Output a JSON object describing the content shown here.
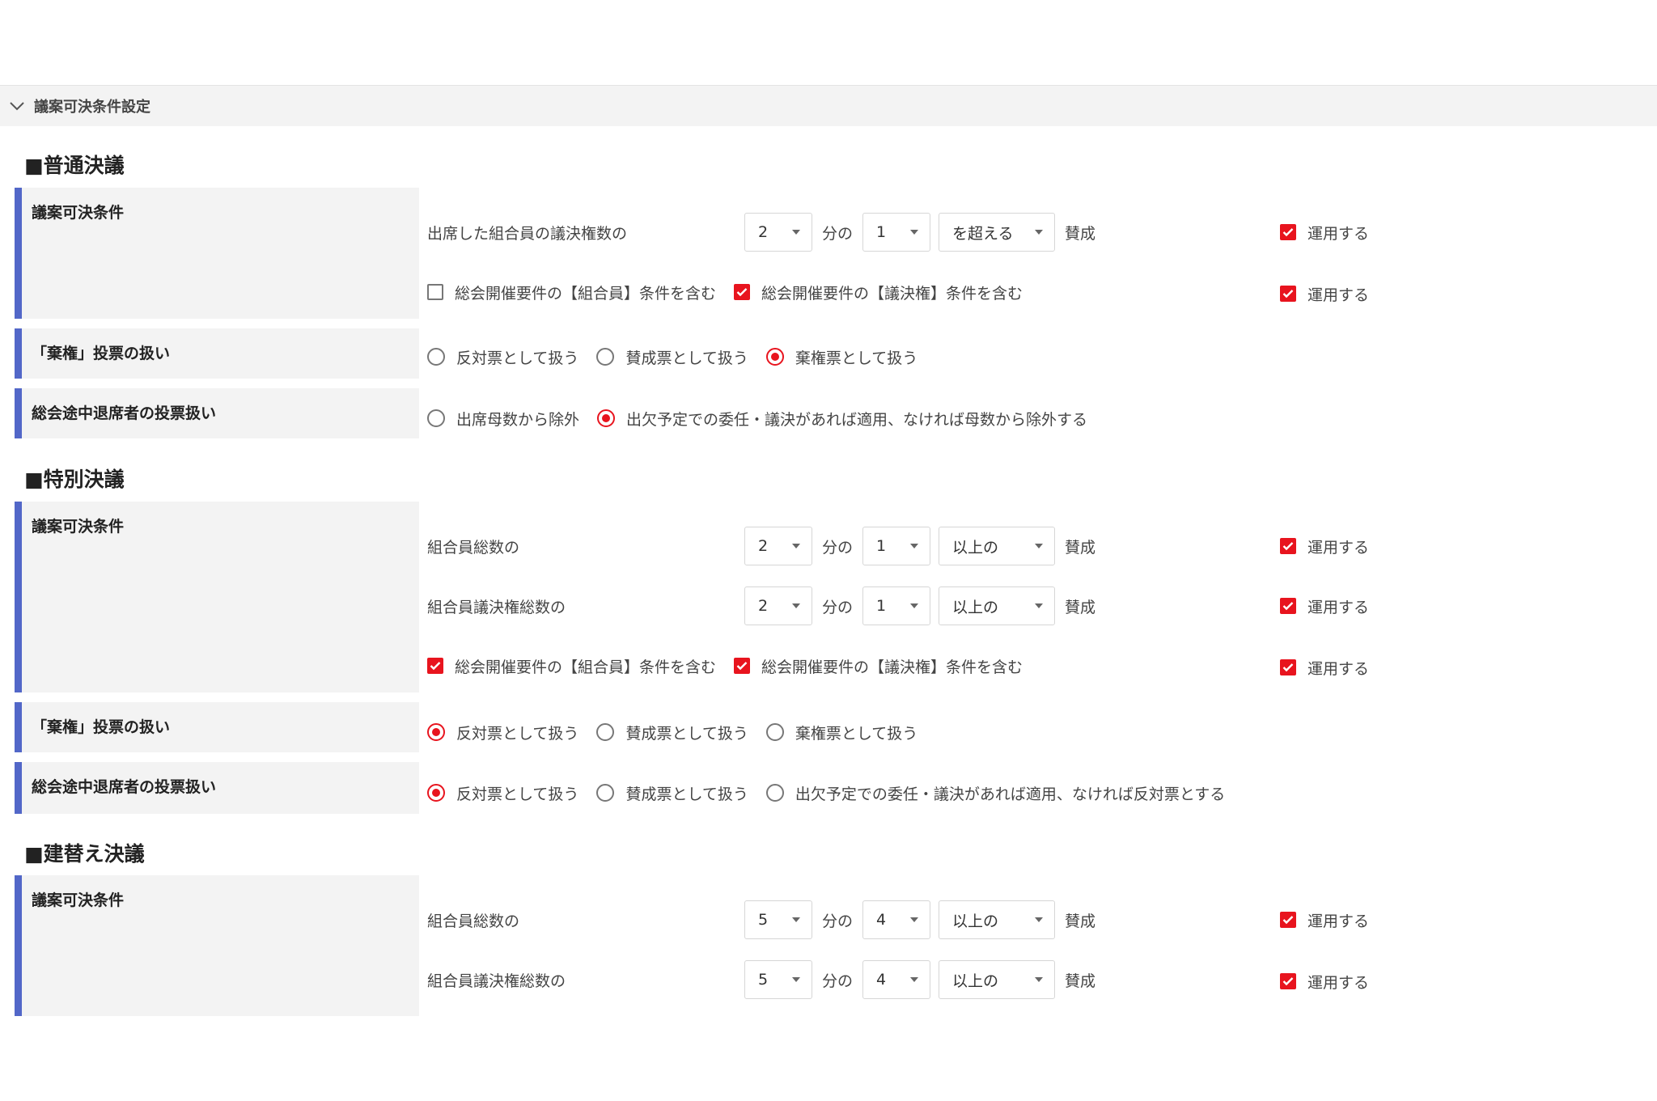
{
  "panel": {
    "title": "議案可決条件設定"
  },
  "apply_label": "運用する",
  "unit_fen": "分の",
  "sansei": "賛成",
  "accent_color": "#e8141e",
  "bar_color": "#5267c8",
  "ordinary": {
    "title": "■普通決議",
    "cond_label": "議案可決条件",
    "abstain_label": "「棄権」投票の扱い",
    "leave_label": "総会途中退席者の投票扱い",
    "row1": {
      "desc": "出席した組合員の議決権数の",
      "denominator": "2",
      "numerator": "1",
      "comparison": "を超える"
    },
    "include_members": "総会開催要件の【組合員】条件を含む",
    "include_votes": "総会開催要件の【議決権】条件を含む",
    "abstain_opts": [
      "反対票として扱う",
      "賛成票として扱う",
      "棄権票として扱う"
    ],
    "leave_opts": [
      "出席母数から除外",
      "出欠予定での委任・議決があれば適用、なければ母数から除外する"
    ]
  },
  "special": {
    "title": "■特別決議",
    "cond_label": "議案可決条件",
    "abstain_label": "「棄権」投票の扱い",
    "leave_label": "総会途中退席者の投票扱い",
    "row1": {
      "desc": "組合員総数の",
      "denominator": "2",
      "numerator": "1",
      "comparison": "以上の"
    },
    "row2": {
      "desc": "組合員議決権総数の",
      "denominator": "2",
      "numerator": "1",
      "comparison": "以上の"
    },
    "include_members": "総会開催要件の【組合員】条件を含む",
    "include_votes": "総会開催要件の【議決権】条件を含む",
    "abstain_opts": [
      "反対票として扱う",
      "賛成票として扱う",
      "棄権票として扱う"
    ],
    "leave_opts": [
      "反対票として扱う",
      "賛成票として扱う",
      "出欠予定での委任・議決があれば適用、なければ反対票とする"
    ]
  },
  "rebuild": {
    "title": "■建替え決議",
    "cond_label": "議案可決条件",
    "row1": {
      "desc": "組合員総数の",
      "denominator": "5",
      "numerator": "4",
      "comparison": "以上の"
    },
    "row2": {
      "desc": "組合員議決権総数の",
      "denominator": "5",
      "numerator": "4",
      "comparison": "以上の"
    }
  }
}
